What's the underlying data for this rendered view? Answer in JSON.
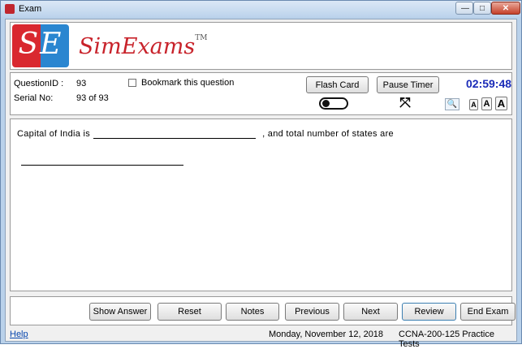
{
  "window": {
    "title": "Exam",
    "controls": {
      "minimize": "—",
      "maximize": "□",
      "close": "✕"
    }
  },
  "logo": {
    "letters": "SE",
    "brand": "SimExams",
    "tm": "TM"
  },
  "info": {
    "question_id_label": "QuestionID :",
    "question_id_value": "93",
    "serial_label": "Serial No:",
    "serial_value": "93 of 93",
    "bookmark_label": "Bookmark this question",
    "flash_card_label": "Flash Card",
    "pause_timer_label": "Pause Timer",
    "timer": "02:59:48",
    "font_sizes": [
      "A",
      "A",
      "A"
    ]
  },
  "question": {
    "text_part1": "Capital of India is",
    "text_part2": ", and total number of states are"
  },
  "nav": {
    "show_answer": "Show Answer",
    "reset": "Reset",
    "notes": "Notes",
    "previous": "Previous",
    "next": "Next",
    "review": "Review",
    "end_exam": "End Exam"
  },
  "status": {
    "help": "Help",
    "date": "Monday, November 12, 2018",
    "exam_name": "CCNA-200-125 Practice Tests"
  },
  "icons": {
    "app": "app-icon",
    "toggle": "toggle-switch-icon",
    "expand": "expand-icon",
    "zoom": "magnifier-icon"
  },
  "colors": {
    "timer": "#1a2bb8",
    "brand_red": "#c8232b",
    "brand_blue": "#2a86d0",
    "link": "#0645ad"
  }
}
